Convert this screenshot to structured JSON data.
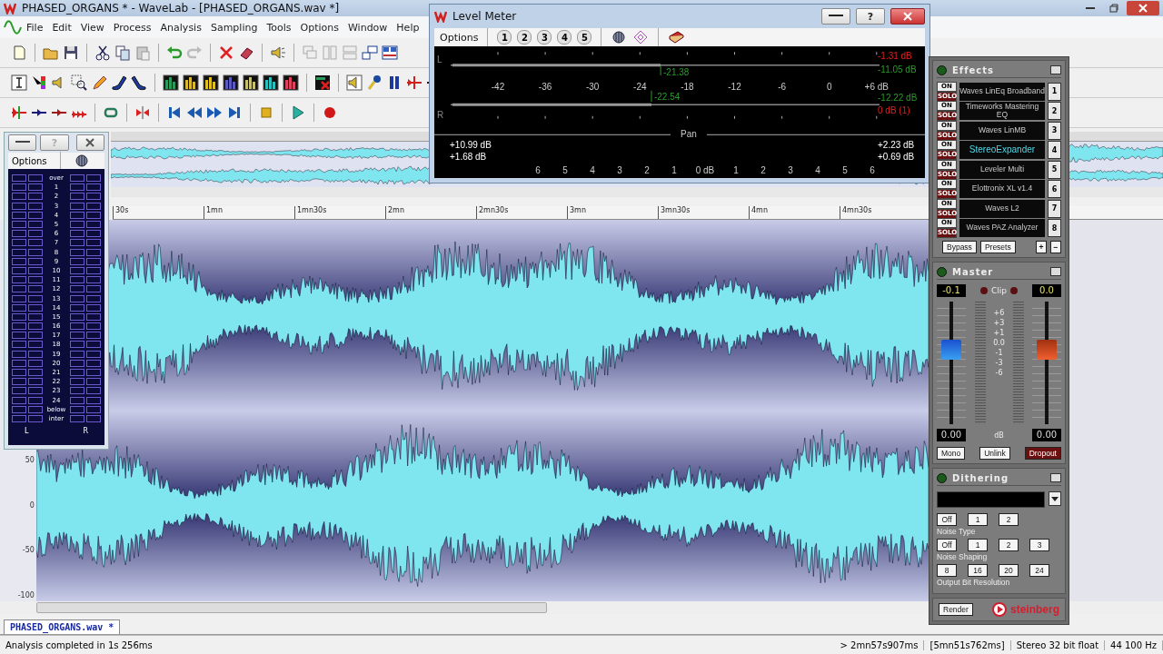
{
  "window": {
    "title": "PHASED_ORGANS * - WaveLab - [PHASED_ORGANS.wav *]"
  },
  "menu": [
    "File",
    "Edit",
    "View",
    "Process",
    "Analysis",
    "Sampling",
    "Tools",
    "Options",
    "Window",
    "Help"
  ],
  "document": {
    "ruler": [
      "30s",
      "1mn",
      "1mn30s",
      "2mn",
      "2mn30s",
      "3mn",
      "3mn30s",
      "4mn",
      "4mn30s"
    ],
    "amplitude_labels": [
      "50",
      "0",
      "-50",
      "-100"
    ],
    "tab": "PHASED_ORGANS.wav *"
  },
  "status_bar": [
    "Analysis completed in 1s 256ms",
    "> 2mn57s907ms",
    "[5mn51s762ms]",
    "Stereo 32 bit float",
    "44 100 Hz"
  ],
  "level_meter": {
    "title": "Level Meter",
    "options": "Options",
    "presets": [
      "1",
      "2",
      "3",
      "4",
      "5"
    ],
    "channels": [
      "L",
      "R"
    ],
    "scale": [
      "-42",
      "-36",
      "-30",
      "-24",
      "-18",
      "-12",
      "-6",
      "0",
      "+6 dB"
    ],
    "peaks": [
      "-21.38",
      "-22.54"
    ],
    "readings": [
      "-1.31 dB",
      "-11.05 dB",
      "-12.22 dB",
      "0 dB (1)"
    ],
    "pan_label": "Pan",
    "pan_readings_left": [
      "+10.99 dB",
      "+1.68 dB"
    ],
    "pan_readings_right": [
      "+2.23 dB",
      "+0.69 dB"
    ],
    "pan_scale": [
      "6",
      "5",
      "4",
      "3",
      "2",
      "1",
      "0 dB",
      "1",
      "2",
      "3",
      "4",
      "5",
      "6"
    ],
    "help": "?"
  },
  "bit_meter": {
    "options": "Options",
    "help": "?",
    "rows": [
      "over",
      "1",
      "2",
      "3",
      "4",
      "5",
      "6",
      "7",
      "8",
      "9",
      "10",
      "11",
      "12",
      "13",
      "14",
      "15",
      "16",
      "17",
      "18",
      "19",
      "20",
      "21",
      "22",
      "23",
      "24",
      "below",
      "inter"
    ],
    "channels": [
      "L",
      "R"
    ]
  },
  "effects": {
    "title": "Effects",
    "slots": [
      {
        "on": "ON",
        "solo": "SOLO",
        "name": "Waves LinEq Broadband",
        "number": "1",
        "selected": false
      },
      {
        "on": "ON",
        "solo": "SOLO",
        "name": "Timeworks Mastering EQ",
        "number": "2",
        "selected": false
      },
      {
        "on": "ON",
        "solo": "SOLO",
        "name": "Waves LinMB",
        "number": "3",
        "selected": false
      },
      {
        "on": "ON",
        "solo": "SOLO",
        "name": "StereoExpander",
        "number": "4",
        "selected": true
      },
      {
        "on": "ON",
        "solo": "SOLO",
        "name": "Leveler Multi",
        "number": "5",
        "selected": false
      },
      {
        "on": "ON",
        "solo": "SOLO",
        "name": "Elottronix XL v1.4",
        "number": "6",
        "selected": false
      },
      {
        "on": "ON",
        "solo": "SOLO",
        "name": "Waves L2",
        "number": "7",
        "selected": false
      },
      {
        "on": "ON",
        "solo": "SOLO",
        "name": "Waves PAZ Analyzer",
        "number": "8",
        "selected": false
      }
    ],
    "buttons": [
      "Bypass",
      "Presets",
      "+",
      "−"
    ]
  },
  "master": {
    "title": "Master",
    "left_gain": "-0.1",
    "clip": "Clip",
    "right_gain": "0.0",
    "scale": [
      "+6",
      "+3",
      "+1",
      "0.0",
      "-1",
      "-3",
      "-6"
    ],
    "faders": [
      {
        "level": 0.66,
        "value": "0.00"
      },
      {
        "level": 0.66,
        "value": "0.00"
      }
    ],
    "unit": "dB",
    "buttons": [
      {
        "label": "Mono",
        "on": false
      },
      {
        "label": "Unlink",
        "on": false
      },
      {
        "label": "Dropout",
        "on": true
      }
    ]
  },
  "dithering": {
    "title": "Dithering",
    "groups": [
      {
        "buttons": [
          "Off",
          "1",
          "2"
        ],
        "label": "Noise Type"
      },
      {
        "buttons": [
          "Off",
          "1",
          "2",
          "3"
        ],
        "label": "Noise Shaping"
      },
      {
        "buttons": [
          "8",
          "16",
          "20",
          "24"
        ],
        "label": "Output Bit Resolution"
      }
    ]
  },
  "render": "Render",
  "brand": "steinberg"
}
